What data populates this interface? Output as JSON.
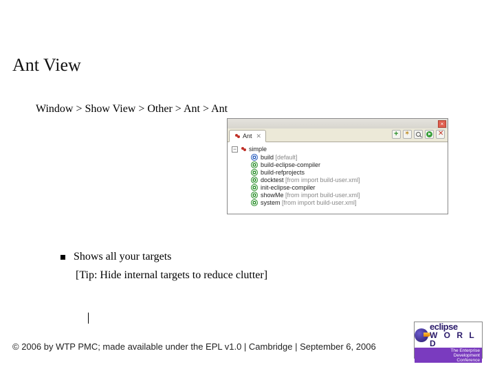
{
  "title": "Ant View",
  "breadcrumb": "Window > Show View >  Other > Ant > Ant",
  "antView": {
    "tabLabel": "Ant",
    "root": "simple",
    "targets": [
      {
        "label": "build",
        "extra": " [default]",
        "default": true
      },
      {
        "label": "build-eclipse-compiler",
        "extra": ""
      },
      {
        "label": "build-refprojects",
        "extra": ""
      },
      {
        "label": "docktest",
        "extra": " [from import build-user.xml]"
      },
      {
        "label": "init-eclipse-compiler",
        "extra": ""
      },
      {
        "label": "showMe",
        "extra": " [from import build-user.xml]"
      },
      {
        "label": "system",
        "extra": " [from import build-user.xml]"
      }
    ]
  },
  "bullet": "Shows all your targets",
  "tip": "[Tip: Hide internal targets to reduce clutter]",
  "footer": "© 2006 by WTP PMC; made available under the EPL v1.0 | Cambridge | September 6, 2006",
  "logo": {
    "brand": "eclipse",
    "sub": "W O R L D",
    "tagline1": "The Enterprise",
    "tagline2": "Development",
    "tagline3": "Conference"
  }
}
